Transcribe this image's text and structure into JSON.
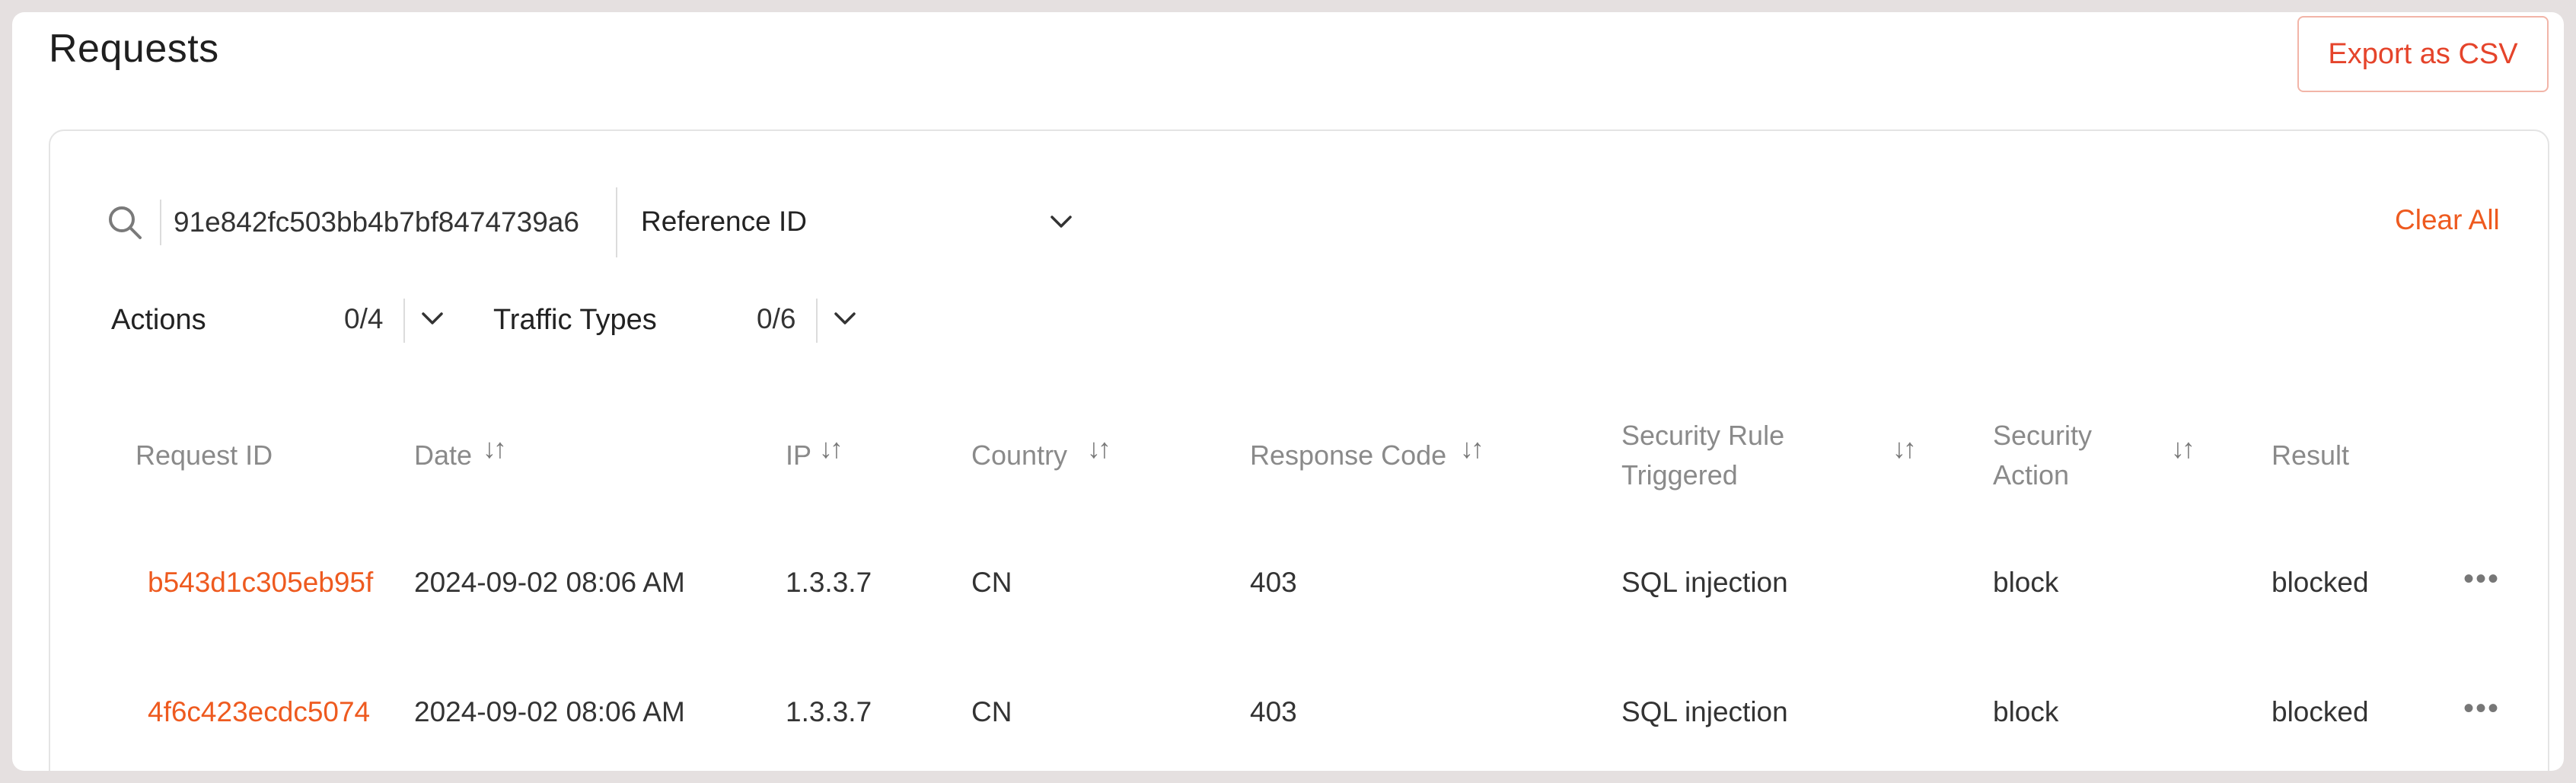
{
  "header": {
    "title": "Requests",
    "export_label": "Export as CSV"
  },
  "search": {
    "value": "91e842fc503bb4b7bf8474739a6",
    "field_label": "Reference ID",
    "clear_label": "Clear All"
  },
  "filters": [
    {
      "label": "Actions",
      "count": "0/4"
    },
    {
      "label": "Traffic Types",
      "count": "0/6"
    }
  ],
  "table": {
    "columns": [
      {
        "label": "Request ID"
      },
      {
        "label": "Date"
      },
      {
        "label": "IP"
      },
      {
        "label": "Country"
      },
      {
        "label": "Response Code"
      },
      {
        "label": "Security Rule Triggered",
        "line1": "Security Rule",
        "line2": "Triggered"
      },
      {
        "label": "Security Action",
        "line1": "Security",
        "line2": "Action"
      },
      {
        "label": "Result"
      }
    ],
    "sort_glyph": "↓↑",
    "more_glyph": "•••",
    "rows": [
      {
        "request_id": "b543d1c305eb95f",
        "date": "2024-09-02 08:06 AM",
        "ip": "1.3.3.7",
        "country": "CN",
        "response_code": "403",
        "security_rule": "SQL injection",
        "security_action": "block",
        "result": "blocked"
      },
      {
        "request_id": "4f6c423ecdc5074",
        "date": "2024-09-02 08:06 AM",
        "ip": "1.3.3.7",
        "country": "CN",
        "response_code": "403",
        "security_rule": "SQL injection",
        "security_action": "block",
        "result": "blocked"
      }
    ]
  },
  "colors": {
    "accent": "#ee5a1f",
    "export_text": "#e5442b",
    "export_border": "#f2b5a8"
  },
  "icons": {
    "search": "search-icon",
    "chevron": "chevron-down-icon",
    "more": "more-horizontal-icon"
  }
}
